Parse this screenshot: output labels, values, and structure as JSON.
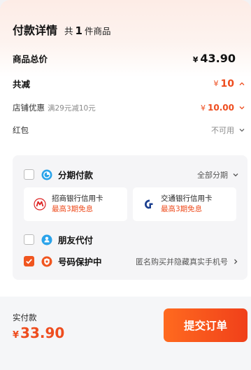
{
  "header": {
    "title": "付款详情",
    "count_prefix": "共",
    "count": "1",
    "count_suffix": "件商品"
  },
  "subtotal": {
    "label": "商品总价",
    "currency": "¥",
    "value": "43.90"
  },
  "discount_total": {
    "label": "共减",
    "currency": "¥",
    "value": "10"
  },
  "shop_discount": {
    "label": "店铺优惠",
    "promo": "满29元减10元",
    "currency": "¥",
    "value": "10.00"
  },
  "red_packet": {
    "label": "红包",
    "value": "不可用"
  },
  "payment": {
    "installment": {
      "label": "分期付款",
      "right_text": "全部分期",
      "checked": false,
      "banks": [
        {
          "name": "招商银行信用卡",
          "promo": "最高3期免息",
          "icon": "cmb-bank-icon"
        },
        {
          "name": "交通银行信用卡",
          "promo": "最高3期免息",
          "icon": "bocom-bank-icon"
        }
      ]
    },
    "friend_pay": {
      "label": "朋友代付",
      "checked": false
    },
    "number_protect": {
      "label": "号码保护中",
      "right_text": "匿名购买并隐藏真实手机号",
      "checked": true
    }
  },
  "footer": {
    "pay_label": "实付款",
    "currency": "¥",
    "amount": "33.90",
    "submit_label": "提交订单"
  },
  "colors": {
    "accent": "#ee4d1f",
    "checkbox_checked": "#f0551f",
    "blue_icon": "#2aa3ea"
  }
}
